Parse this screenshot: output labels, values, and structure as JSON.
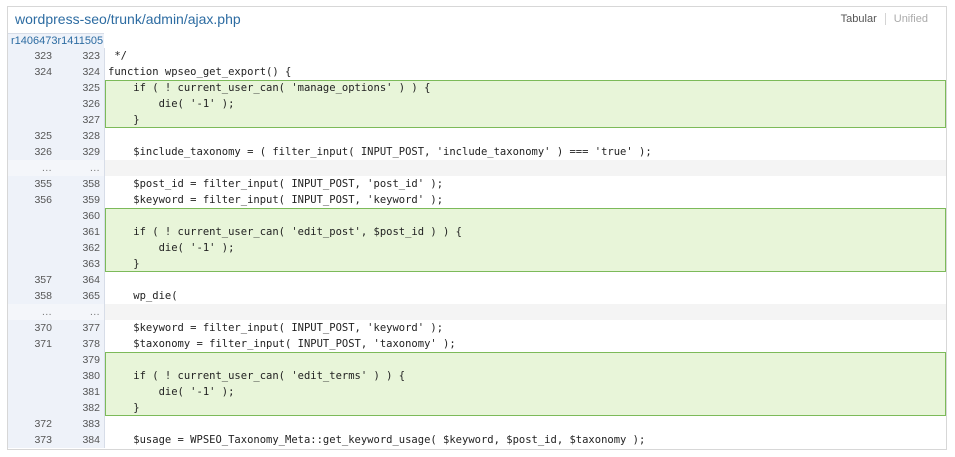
{
  "header": {
    "title": "wordpress-seo/trunk/admin/ajax.php",
    "views": [
      "Tabular",
      "Unified"
    ]
  },
  "revisions": [
    "r1406473",
    "r1411505"
  ],
  "diff": {
    "rows": [
      {
        "type": "ctx",
        "old": "323",
        "new": "323",
        "code": " */"
      },
      {
        "type": "ctx",
        "old": "324",
        "new": "324",
        "code": "function wpseo_get_export() {"
      },
      {
        "type": "add",
        "pos": "first",
        "old": "",
        "new": "325",
        "code": "    if ( ! current_user_can( 'manage_options' ) ) {"
      },
      {
        "type": "add",
        "pos": "mid",
        "old": "",
        "new": "326",
        "code": "        die( '-1' );"
      },
      {
        "type": "add",
        "pos": "last",
        "old": "",
        "new": "327",
        "code": "    }"
      },
      {
        "type": "ctx",
        "old": "325",
        "new": "328",
        "code": ""
      },
      {
        "type": "ctx",
        "old": "326",
        "new": "329",
        "code": "    $include_taxonomy = ( filter_input( INPUT_POST, 'include_taxonomy' ) === 'true' );"
      },
      {
        "type": "skip",
        "old": "…",
        "new": "…",
        "code": ""
      },
      {
        "type": "ctx",
        "old": "355",
        "new": "358",
        "code": "    $post_id = filter_input( INPUT_POST, 'post_id' );"
      },
      {
        "type": "ctx",
        "old": "356",
        "new": "359",
        "code": "    $keyword = filter_input( INPUT_POST, 'keyword' );"
      },
      {
        "type": "add",
        "pos": "first",
        "old": "",
        "new": "360",
        "code": ""
      },
      {
        "type": "add",
        "pos": "mid",
        "old": "",
        "new": "361",
        "code": "    if ( ! current_user_can( 'edit_post', $post_id ) ) {"
      },
      {
        "type": "add",
        "pos": "mid",
        "old": "",
        "new": "362",
        "code": "        die( '-1' );"
      },
      {
        "type": "add",
        "pos": "last",
        "old": "",
        "new": "363",
        "code": "    }"
      },
      {
        "type": "ctx",
        "old": "357",
        "new": "364",
        "code": ""
      },
      {
        "type": "ctx",
        "old": "358",
        "new": "365",
        "code": "    wp_die("
      },
      {
        "type": "skip",
        "old": "…",
        "new": "…",
        "code": ""
      },
      {
        "type": "ctx",
        "old": "370",
        "new": "377",
        "code": "    $keyword = filter_input( INPUT_POST, 'keyword' );"
      },
      {
        "type": "ctx",
        "old": "371",
        "new": "378",
        "code": "    $taxonomy = filter_input( INPUT_POST, 'taxonomy' );"
      },
      {
        "type": "add",
        "pos": "first",
        "old": "",
        "new": "379",
        "code": ""
      },
      {
        "type": "add",
        "pos": "mid",
        "old": "",
        "new": "380",
        "code": "    if ( ! current_user_can( 'edit_terms' ) ) {"
      },
      {
        "type": "add",
        "pos": "mid",
        "old": "",
        "new": "381",
        "code": "        die( '-1' );"
      },
      {
        "type": "add",
        "pos": "last",
        "old": "",
        "new": "382",
        "code": "    }"
      },
      {
        "type": "ctx",
        "old": "372",
        "new": "383",
        "code": ""
      },
      {
        "type": "ctx",
        "old": "373",
        "new": "384",
        "code": "    $usage = WPSEO_Taxonomy_Meta::get_keyword_usage( $keyword, $post_id, $taxonomy );"
      }
    ]
  },
  "colors": {
    "added_bg": "#e8f5d9",
    "added_border": "#7cba59",
    "gutter_bg": "#eef2f9",
    "link": "#2d6ca2"
  }
}
